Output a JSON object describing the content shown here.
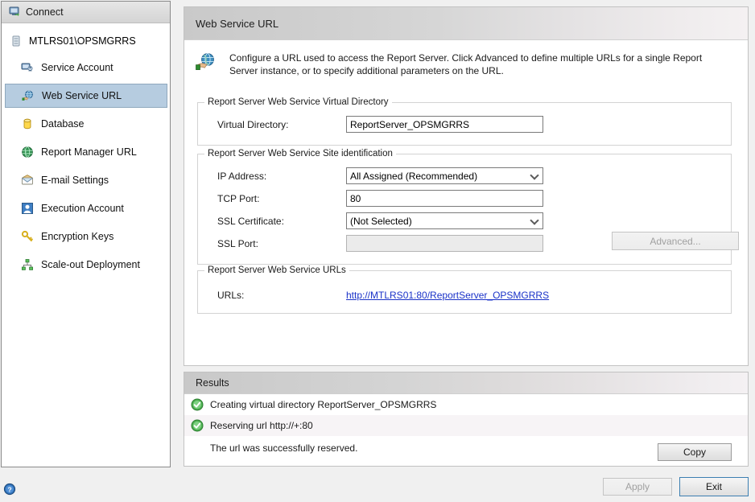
{
  "sidebar": {
    "connect_label": "Connect",
    "connect_icon": "connect-server-icon",
    "server": {
      "label": "MTLRS01\\OPSMGRRS",
      "icon": "server-instance-icon"
    },
    "items": [
      {
        "label": "Service Account",
        "icon": "service-account-icon",
        "selected": false
      },
      {
        "label": "Web Service URL",
        "icon": "web-service-url-icon",
        "selected": true
      },
      {
        "label": "Database",
        "icon": "database-icon",
        "selected": false
      },
      {
        "label": "Report Manager URL",
        "icon": "report-manager-url-icon",
        "selected": false
      },
      {
        "label": "E-mail Settings",
        "icon": "email-settings-icon",
        "selected": false
      },
      {
        "label": "Execution Account",
        "icon": "execution-account-icon",
        "selected": false
      },
      {
        "label": "Encryption Keys",
        "icon": "encryption-keys-icon",
        "selected": false
      },
      {
        "label": "Scale-out Deployment",
        "icon": "scale-out-deployment-icon",
        "selected": false
      }
    ]
  },
  "main": {
    "title": "Web Service URL",
    "description": "Configure a URL used to access the Report Server.  Click Advanced to define multiple URLs for a single Report Server instance, or to specify additional parameters on the URL.",
    "description_icon": "globe-in-hand-icon",
    "virtual_directory_group": {
      "legend": "Report Server Web Service Virtual Directory",
      "field_label": "Virtual Directory:",
      "field_value": "ReportServer_OPSMGRRS"
    },
    "site_identification_group": {
      "legend": "Report Server Web Service Site identification",
      "ip_address_label": "IP Address:",
      "ip_address_value": "All Assigned (Recommended)",
      "tcp_port_label": "TCP Port:",
      "tcp_port_value": "80",
      "ssl_certificate_label": "SSL Certificate:",
      "ssl_certificate_value": "(Not Selected)",
      "ssl_port_label": "SSL Port:",
      "ssl_port_value": "",
      "advanced_button_label": "Advanced..."
    },
    "urls_group": {
      "legend": "Report Server Web Service URLs",
      "urls_label": "URLs:",
      "url_value": "http://MTLRS01:80/ReportServer_OPSMGRRS"
    }
  },
  "results": {
    "title": "Results",
    "rows": [
      {
        "icon": "success-check-icon",
        "text": "Creating virtual directory ReportServer_OPSMGRRS"
      },
      {
        "icon": "success-check-icon",
        "text": "Reserving url http://+:80"
      }
    ],
    "detail_text": "The url was successfully reserved.",
    "copy_button_label": "Copy"
  },
  "footer": {
    "help_icon": "help-icon",
    "apply_label": "Apply",
    "exit_label": "Exit"
  },
  "colors": {
    "selection": "#b6cce0",
    "link": "#1a32c8",
    "success": "#3c9c3c",
    "focus_border": "#3c7fb1"
  }
}
